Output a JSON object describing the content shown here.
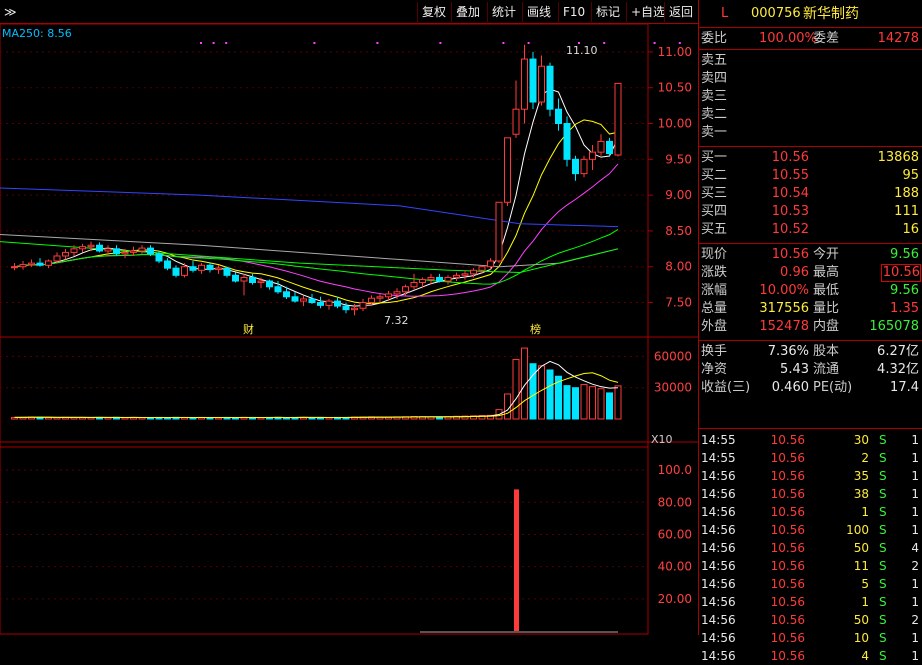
{
  "toolbar": {
    "left_glyph": "≫",
    "buttons": [
      "复权",
      "叠加",
      "统计",
      "画线",
      "F10",
      "标记",
      "+自选",
      "返回"
    ]
  },
  "chart": {
    "ma_label": "MA250: 8.56",
    "high_marker": "11.10",
    "low_marker": "7.32",
    "tag_cai": "财",
    "tag_bang": "榜",
    "vol_multiplier": "X10",
    "price_axis": [
      "11.00",
      "10.50",
      "10.00",
      "9.50",
      "9.00",
      "8.50",
      "8.00",
      "7.50"
    ],
    "volume_axis": [
      "60000",
      "30000"
    ],
    "indicator_axis": [
      "100.0",
      "80.00",
      "60.00",
      "40.00",
      "20.00"
    ],
    "colors": {
      "up": "#ff3a3a",
      "down": "#00e5ff",
      "ma5": "#ffffff",
      "ma10": "#ffff00",
      "ma20": "#ff40ff",
      "ma60": "#00ff00",
      "ma120": "#aaaaaa",
      "ma250": "#3344ff",
      "frame": "#aa0000"
    }
  },
  "chart_data": {
    "type": "candlestick",
    "ohlc": [
      [
        8.0,
        8.05,
        7.95,
        8.0
      ],
      [
        8.0,
        8.08,
        7.96,
        8.03
      ],
      [
        8.03,
        8.1,
        8.0,
        8.05
      ],
      [
        8.05,
        8.12,
        8.0,
        8.02
      ],
      [
        8.02,
        8.1,
        7.98,
        8.08
      ],
      [
        8.08,
        8.2,
        8.05,
        8.15
      ],
      [
        8.15,
        8.25,
        8.1,
        8.2
      ],
      [
        8.2,
        8.3,
        8.15,
        8.25
      ],
      [
        8.25,
        8.32,
        8.2,
        8.28
      ],
      [
        8.28,
        8.35,
        8.22,
        8.3
      ],
      [
        8.3,
        8.34,
        8.2,
        8.22
      ],
      [
        8.22,
        8.3,
        8.15,
        8.25
      ],
      [
        8.25,
        8.3,
        8.15,
        8.18
      ],
      [
        8.18,
        8.25,
        8.12,
        8.2
      ],
      [
        8.2,
        8.28,
        8.15,
        8.22
      ],
      [
        8.22,
        8.3,
        8.18,
        8.26
      ],
      [
        8.26,
        8.3,
        8.15,
        8.18
      ],
      [
        8.18,
        8.22,
        8.05,
        8.08
      ],
      [
        8.08,
        8.12,
        7.95,
        7.98
      ],
      [
        7.98,
        8.02,
        7.85,
        7.88
      ],
      [
        7.88,
        8.05,
        7.85,
        8.0
      ],
      [
        8.0,
        8.08,
        7.92,
        7.95
      ],
      [
        7.95,
        8.05,
        7.9,
        8.02
      ],
      [
        8.02,
        8.06,
        7.92,
        7.96
      ],
      [
        7.96,
        8.02,
        7.9,
        7.98
      ],
      [
        7.98,
        8.0,
        7.85,
        7.88
      ],
      [
        7.88,
        7.92,
        7.78,
        7.8
      ],
      [
        7.8,
        7.9,
        7.6,
        7.85
      ],
      [
        7.85,
        7.9,
        7.75,
        7.78
      ],
      [
        7.78,
        7.85,
        7.7,
        7.8
      ],
      [
        7.8,
        7.82,
        7.68,
        7.72
      ],
      [
        7.72,
        7.8,
        7.62,
        7.65
      ],
      [
        7.65,
        7.72,
        7.55,
        7.58
      ],
      [
        7.58,
        7.65,
        7.5,
        7.52
      ],
      [
        7.52,
        7.6,
        7.45,
        7.55
      ],
      [
        7.55,
        7.62,
        7.48,
        7.5
      ],
      [
        7.5,
        7.58,
        7.42,
        7.46
      ],
      [
        7.46,
        7.55,
        7.4,
        7.52
      ],
      [
        7.52,
        7.58,
        7.42,
        7.45
      ],
      [
        7.45,
        7.5,
        7.35,
        7.4
      ],
      [
        7.4,
        7.48,
        7.32,
        7.42
      ],
      [
        7.42,
        7.55,
        7.38,
        7.5
      ],
      [
        7.5,
        7.6,
        7.45,
        7.56
      ],
      [
        7.56,
        7.62,
        7.5,
        7.58
      ],
      [
        7.58,
        7.66,
        7.52,
        7.62
      ],
      [
        7.62,
        7.7,
        7.55,
        7.65
      ],
      [
        7.65,
        7.75,
        7.6,
        7.72
      ],
      [
        7.72,
        7.9,
        7.68,
        7.78
      ],
      [
        7.78,
        7.85,
        7.7,
        7.82
      ],
      [
        7.82,
        7.9,
        7.75,
        7.85
      ],
      [
        7.85,
        7.9,
        7.78,
        7.8
      ],
      [
        7.8,
        7.88,
        7.75,
        7.85
      ],
      [
        7.85,
        7.92,
        7.8,
        7.88
      ],
      [
        7.88,
        7.95,
        7.82,
        7.9
      ],
      [
        7.9,
        7.98,
        7.85,
        7.95
      ],
      [
        7.95,
        8.02,
        7.9,
        8.0
      ],
      [
        8.0,
        8.12,
        7.96,
        8.08
      ],
      [
        8.08,
        8.9,
        8.05,
        8.9
      ],
      [
        8.9,
        9.8,
        8.85,
        9.8
      ],
      [
        9.85,
        10.6,
        9.8,
        10.2
      ],
      [
        10.2,
        11.1,
        10.0,
        10.9
      ],
      [
        10.9,
        11.0,
        10.2,
        10.3
      ],
      [
        10.3,
        10.95,
        10.25,
        10.8
      ],
      [
        10.8,
        10.85,
        10.1,
        10.2
      ],
      [
        10.2,
        10.35,
        9.9,
        10.0
      ],
      [
        10.0,
        10.1,
        9.4,
        9.5
      ],
      [
        9.5,
        9.55,
        9.2,
        9.3
      ],
      [
        9.3,
        9.55,
        9.25,
        9.5
      ],
      [
        9.5,
        9.7,
        9.35,
        9.6
      ],
      [
        9.6,
        9.85,
        9.55,
        9.75
      ],
      [
        9.75,
        9.8,
        9.55,
        9.58
      ],
      [
        9.56,
        10.56,
        9.54,
        10.56
      ]
    ],
    "volume": [
      1500,
      1600,
      1800,
      1700,
      1500,
      1400,
      1600,
      1500,
      1500,
      1400,
      1500,
      1400,
      1600,
      1500,
      1500,
      1400,
      1300,
      1500,
      1400,
      1600,
      1500,
      1400,
      1500,
      1400,
      1300,
      1500,
      1400,
      1600,
      1500,
      1400,
      1500,
      1600,
      1400,
      1500,
      1600,
      1400,
      1500,
      1400,
      1500,
      1500,
      1800,
      1900,
      2000,
      1800,
      1700,
      2000,
      2200,
      2400,
      2200,
      2000,
      2000,
      2200,
      2600,
      2800,
      3000,
      3200,
      3500,
      9000,
      24000,
      57000,
      68000,
      53000,
      51000,
      47000,
      41000,
      32000,
      30000,
      33000,
      31000,
      29000,
      25000,
      31755
    ],
    "latest_close": 10.56,
    "ylim_price": [
      7.2,
      11.25
    ],
    "ylim_volume": [
      0,
      70000
    ],
    "ylim_indicator": [
      0,
      110
    ],
    "indicator_bar_value": 88
  },
  "quote": {
    "market_tag": "L",
    "code": "000756",
    "name": "新华制药",
    "weibi_label": "委比",
    "weibi_val": "100.00%",
    "weicha_label": "委差",
    "weicha_val": "14278",
    "asks": [
      {
        "label": "卖五",
        "price": "",
        "vol": ""
      },
      {
        "label": "卖四",
        "price": "",
        "vol": ""
      },
      {
        "label": "卖三",
        "price": "",
        "vol": ""
      },
      {
        "label": "卖二",
        "price": "",
        "vol": ""
      },
      {
        "label": "卖一",
        "price": "",
        "vol": ""
      }
    ],
    "bids": [
      {
        "label": "买一",
        "price": "10.56",
        "vol": "13868"
      },
      {
        "label": "买二",
        "price": "10.55",
        "vol": "95"
      },
      {
        "label": "买三",
        "price": "10.54",
        "vol": "188"
      },
      {
        "label": "买四",
        "price": "10.53",
        "vol": "111"
      },
      {
        "label": "买五",
        "price": "10.52",
        "vol": "16"
      }
    ],
    "stats": [
      {
        "l1": "现价",
        "v1": "10.56",
        "c1": "red",
        "l2": "今开",
        "v2": "9.56",
        "c2": "grn"
      },
      {
        "l1": "涨跌",
        "v1": "0.96",
        "c1": "red",
        "l2": "最高",
        "v2": "10.56",
        "c2": "red"
      },
      {
        "l1": "涨幅",
        "v1": "10.00%",
        "c1": "red",
        "l2": "最低",
        "v2": "9.56",
        "c2": "grn"
      },
      {
        "l1": "总量",
        "v1": "317556",
        "c1": "yel",
        "l2": "量比",
        "v2": "1.35",
        "c2": "red"
      },
      {
        "l1": "外盘",
        "v1": "152478",
        "c1": "red",
        "l2": "内盘",
        "v2": "165078",
        "c2": "grn"
      }
    ],
    "fund": [
      {
        "l1": "换手",
        "v1": "7.36%",
        "l2": "股本",
        "v2": "6.27亿"
      },
      {
        "l1": "净资",
        "v1": "5.43",
        "l2": "流通",
        "v2": "4.32亿"
      },
      {
        "l1": "收益(三)",
        "v1": "0.460",
        "l2": "PE(动)",
        "v2": "17.4"
      }
    ],
    "ticks": [
      {
        "time": "14:55",
        "price": "10.56",
        "vol": "30",
        "side": "S",
        "n": "1"
      },
      {
        "time": "14:55",
        "price": "10.56",
        "vol": "2",
        "side": "S",
        "n": "1"
      },
      {
        "time": "14:56",
        "price": "10.56",
        "vol": "35",
        "side": "S",
        "n": "1"
      },
      {
        "time": "14:56",
        "price": "10.56",
        "vol": "38",
        "side": "S",
        "n": "1"
      },
      {
        "time": "14:56",
        "price": "10.56",
        "vol": "1",
        "side": "S",
        "n": "1"
      },
      {
        "time": "14:56",
        "price": "10.56",
        "vol": "100",
        "side": "S",
        "n": "1"
      },
      {
        "time": "14:56",
        "price": "10.56",
        "vol": "50",
        "side": "S",
        "n": "4"
      },
      {
        "time": "14:56",
        "price": "10.56",
        "vol": "11",
        "side": "S",
        "n": "2"
      },
      {
        "time": "14:56",
        "price": "10.56",
        "vol": "5",
        "side": "S",
        "n": "1"
      },
      {
        "time": "14:56",
        "price": "10.56",
        "vol": "1",
        "side": "S",
        "n": "1"
      },
      {
        "time": "14:56",
        "price": "10.56",
        "vol": "50",
        "side": "S",
        "n": "2"
      },
      {
        "time": "14:56",
        "price": "10.56",
        "vol": "10",
        "side": "S",
        "n": "1"
      },
      {
        "time": "14:56",
        "price": "10.56",
        "vol": "4",
        "side": "S",
        "n": "1"
      }
    ]
  }
}
